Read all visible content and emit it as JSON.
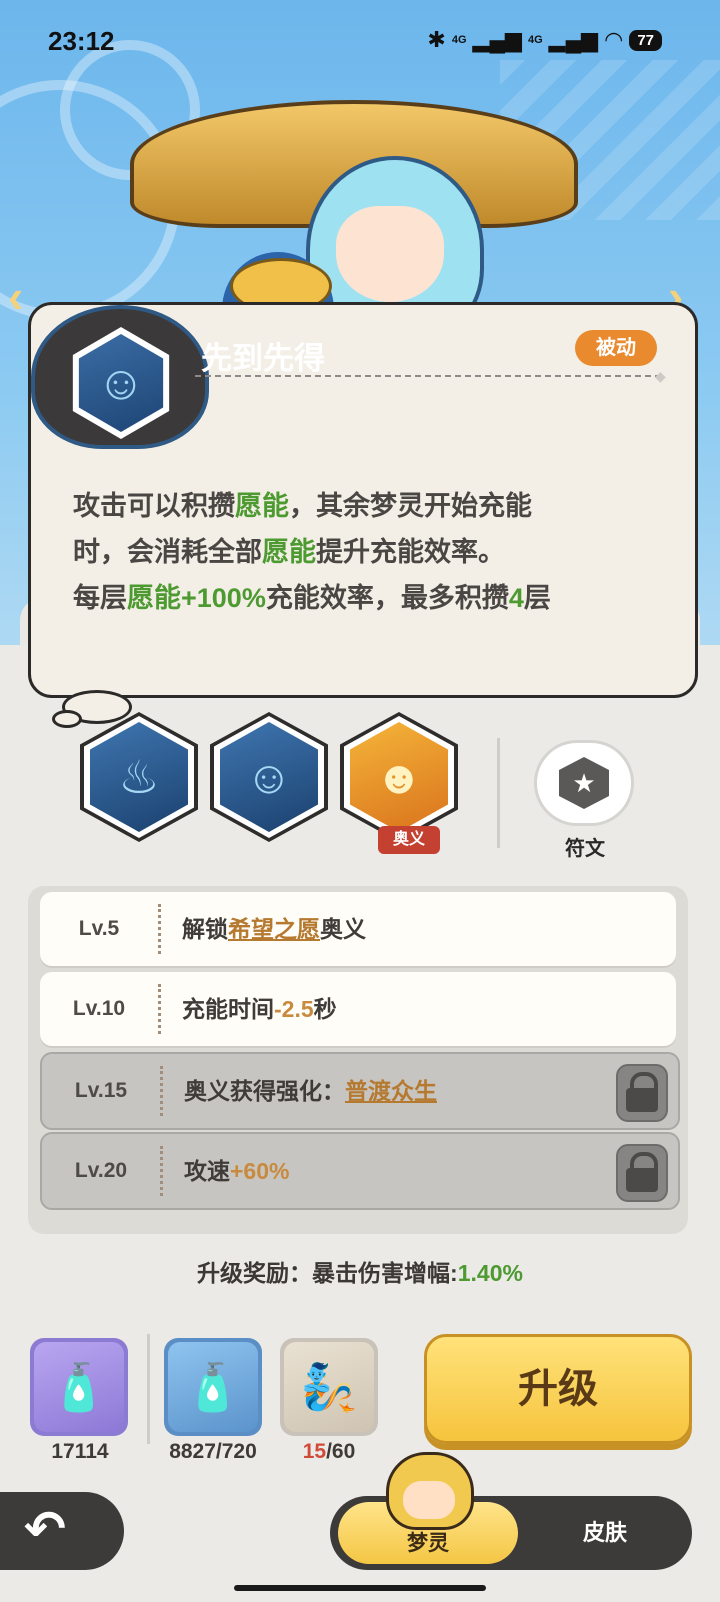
{
  "status_bar": {
    "time": "23:12",
    "network1": "4G",
    "network2": "4G",
    "battery": "77"
  },
  "skill": {
    "title": "先到先得",
    "tag": "被动",
    "desc_line1": [
      {
        "t": "攻击可以积攒",
        "g": false
      },
      {
        "t": "愿能",
        "g": true
      },
      {
        "t": "，其余梦灵开始充能",
        "g": false
      }
    ],
    "desc_line2": [
      {
        "t": "时，会消耗全部",
        "g": false
      },
      {
        "t": "愿能",
        "g": true
      },
      {
        "t": "提升充能效率。",
        "g": false
      }
    ],
    "desc_line3": [
      {
        "t": "每层",
        "g": false
      },
      {
        "t": "愿能+100%",
        "g": true
      },
      {
        "t": "充能效率，最多积攒",
        "g": false
      },
      {
        "t": "4",
        "g": true
      },
      {
        "t": "层",
        "g": false
      }
    ]
  },
  "skill_slots": {
    "ultimate_badge": "奥义",
    "rune_label": "符文"
  },
  "levels": [
    {
      "lv": "Lv.5",
      "pre": "解锁",
      "hl": "希望之愿",
      "post": "奥义",
      "hl_style": "u",
      "locked": false
    },
    {
      "lv": "Lv.10",
      "pre": "充能时间",
      "hl": "-2.5",
      "post": "秒",
      "hl_style": "o",
      "locked": false
    },
    {
      "lv": "Lv.15",
      "pre": "奥义获得强化：",
      "hl": "普渡众生",
      "post": "",
      "hl_style": "u",
      "locked": true
    },
    {
      "lv": "Lv.20",
      "pre": "攻速",
      "hl": "+60%",
      "post": "",
      "hl_style": "o",
      "locked": true
    }
  ],
  "reward": {
    "label": "升级奖励：暴击伤害增幅:",
    "value": "1.40%"
  },
  "resources": [
    {
      "icon": "rainbow-bottle-icon",
      "count": "17114"
    },
    {
      "icon": "gold-bottle-icon",
      "count": "8827/720"
    },
    {
      "icon": "genie-shard-icon",
      "count_hl": "15",
      "count_rest": "/60"
    }
  ],
  "upgrade_label": "升级",
  "tabs": {
    "active": "梦灵",
    "second": "皮肤"
  },
  "colors": {
    "accent_green": "#4d9a31",
    "tag_orange": "#e98a2e",
    "button_gold": "#f6c43d"
  }
}
